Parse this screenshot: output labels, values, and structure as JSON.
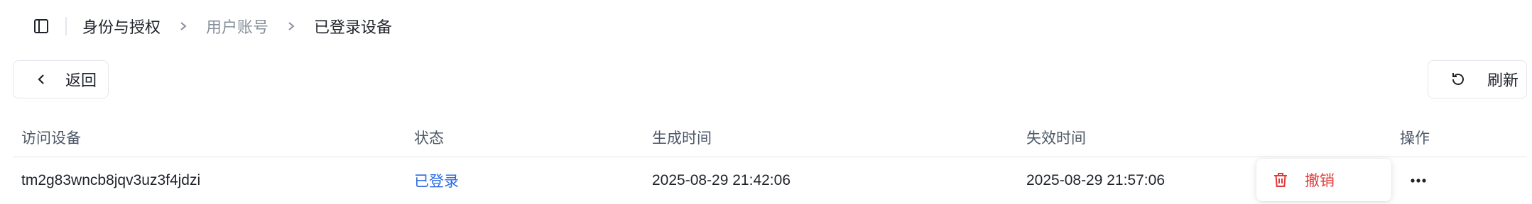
{
  "breadcrumb": {
    "items": [
      {
        "label": "身份与授权"
      },
      {
        "label": "用户账号"
      },
      {
        "label": "已登录设备"
      }
    ]
  },
  "toolbar": {
    "back_label": "返回",
    "refresh_label": "刷新"
  },
  "table": {
    "columns": [
      "访问设备",
      "状态",
      "生成时间",
      "失效时间",
      "操作"
    ],
    "rows": [
      {
        "device": "tm2g83wncb8jqv3uz3f4jdzi",
        "status": "已登录",
        "created": "2025-08-29 21:42:06",
        "expires": "2025-08-29 21:57:06"
      }
    ]
  },
  "popup_menu": {
    "items": [
      {
        "label": "撤销",
        "icon": "trash-icon"
      }
    ]
  },
  "icons": {
    "sidebar_toggle": "sidebar-toggle-icon",
    "breadcrumb_separator": "chevron-right-icon",
    "back": "chevron-left-icon",
    "refresh": "refresh-icon",
    "more": "more-horizontal-icon"
  },
  "colors": {
    "link_blue": "#2b6be6",
    "danger_red": "#e03a3a",
    "muted_text": "#86909c",
    "border": "#e5e6eb"
  }
}
